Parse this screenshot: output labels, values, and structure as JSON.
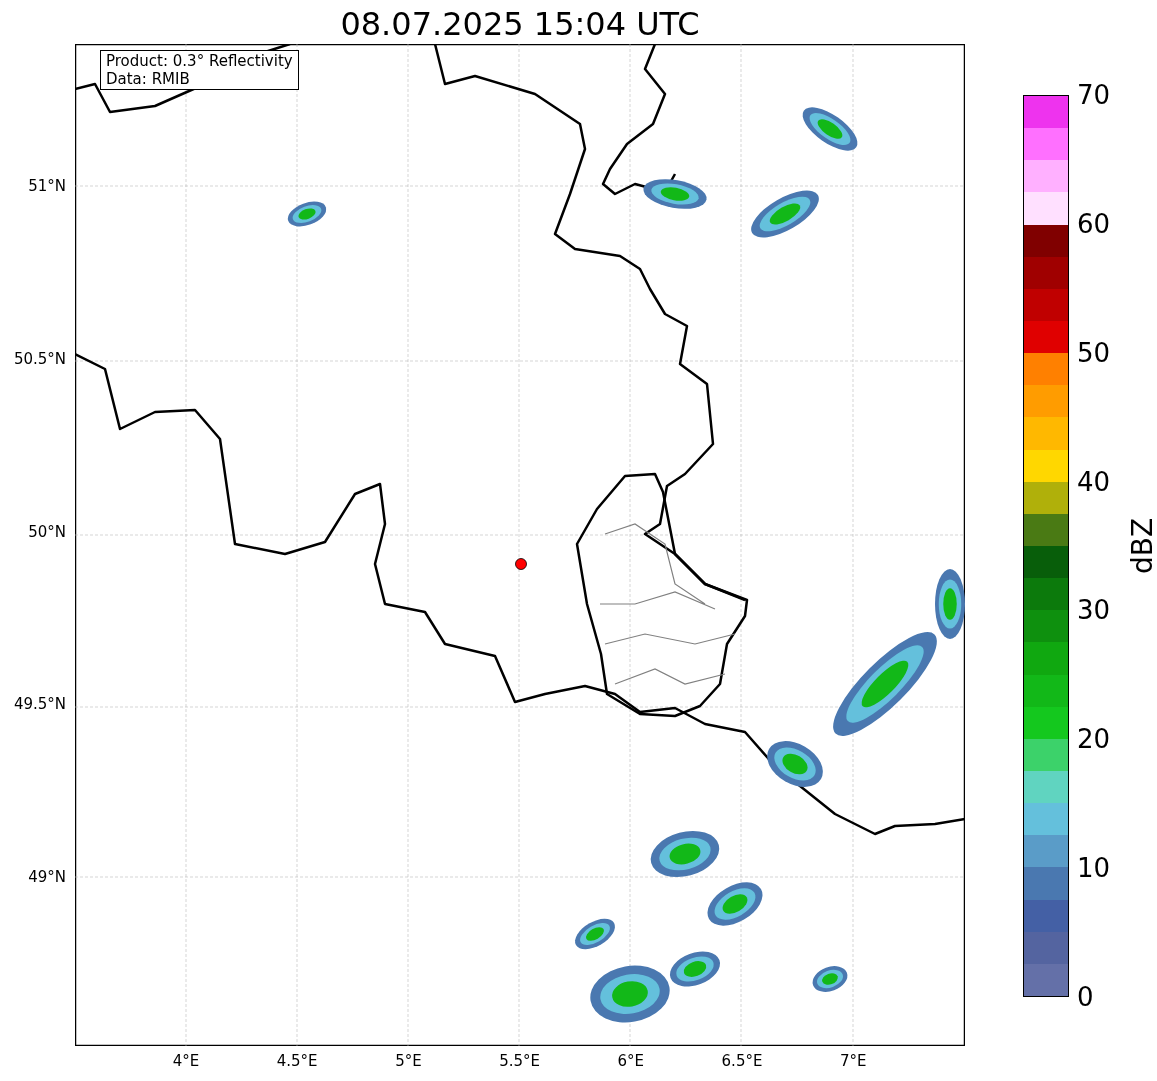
{
  "title": "08.07.2025 15:04 UTC",
  "map": {
    "legend": [
      "Product: 0.3° Reflectivity",
      "Data: RMIB"
    ],
    "lat_labels": [
      "51°N",
      "50.5°N",
      "50°N",
      "49.5°N",
      "49°N"
    ],
    "lon_labels": [
      "4°E",
      "4.5°E",
      "5°E",
      "5.5°E",
      "6°E",
      "6.5°E",
      "7°E"
    ]
  },
  "colorbar": {
    "label": "dBZ",
    "ticks": [
      "70",
      "60",
      "50",
      "40",
      "30",
      "20",
      "10",
      "0"
    ],
    "bands": [
      {
        "color": "#ee33ee"
      },
      {
        "color": "#ff70ff"
      },
      {
        "color": "#ffb0ff"
      },
      {
        "color": "#ffe0ff"
      },
      {
        "color": "#800000"
      },
      {
        "color": "#a00000"
      },
      {
        "color": "#c00000"
      },
      {
        "color": "#e00000"
      },
      {
        "color": "#ff8000"
      },
      {
        "color": "#ff9c00"
      },
      {
        "color": "#ffb800"
      },
      {
        "color": "#ffd700"
      },
      {
        "color": "#b0b00a"
      },
      {
        "color": "#4a7a14"
      },
      {
        "color": "#085e0a"
      },
      {
        "color": "#0c7a0c"
      },
      {
        "color": "#0e900e"
      },
      {
        "color": "#10a810"
      },
      {
        "color": "#12b818"
      },
      {
        "color": "#14c81e"
      },
      {
        "color": "#3cd26a"
      },
      {
        "color": "#60d4c0"
      },
      {
        "color": "#64c0dc"
      },
      {
        "color": "#5a9cc8"
      },
      {
        "color": "#4a78b0"
      },
      {
        "color": "#4460a5"
      },
      {
        "color": "#5464a0"
      },
      {
        "color": "#6470a8"
      }
    ]
  }
}
